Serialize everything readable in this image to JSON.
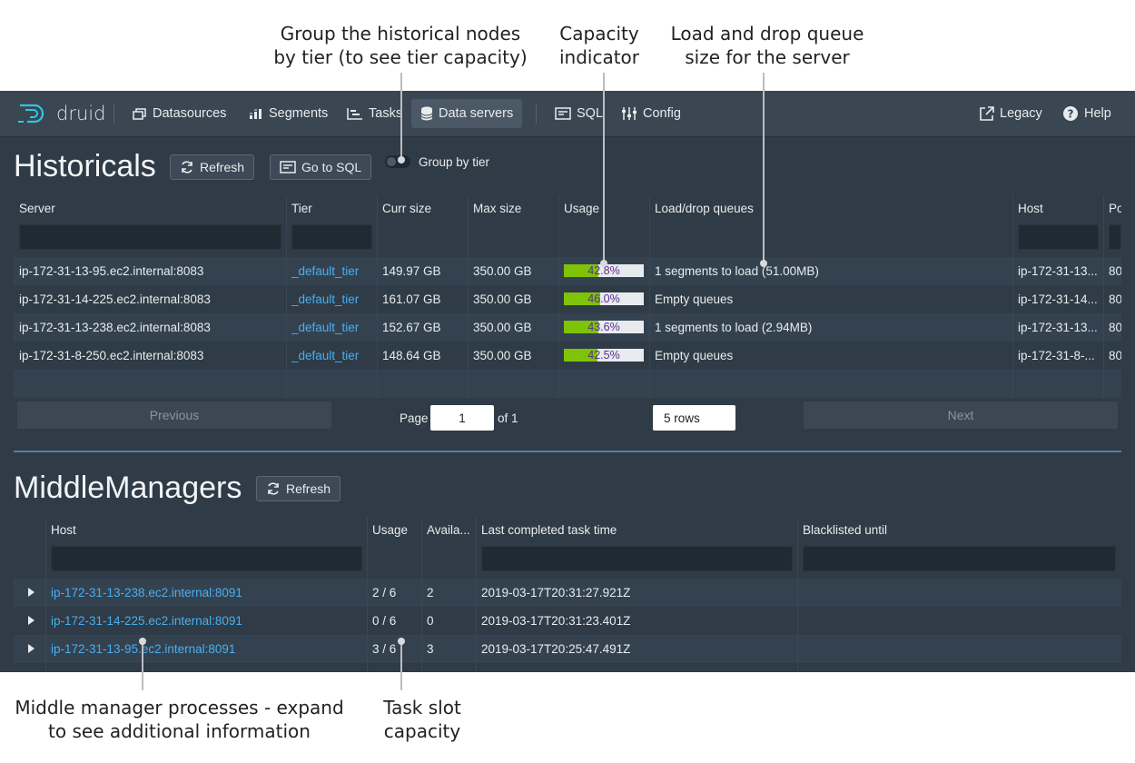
{
  "annotations": {
    "group_by_tier": "Group the historical nodes\nby tier (to see tier capacity)",
    "capacity": "Capacity\nindicator",
    "load_drop": "Load and drop queue\nsize for the server",
    "middle_managers": "Middle manager processes - expand\nto see additional information",
    "task_slot": "Task slot\ncapacity"
  },
  "nav": {
    "brand": "druid",
    "items": [
      "Datasources",
      "Segments",
      "Tasks",
      "Data servers",
      "SQL",
      "Config"
    ],
    "active": "Data servers",
    "right": [
      "Legacy",
      "Help"
    ]
  },
  "historicals": {
    "title": "Historicals",
    "refresh": "Refresh",
    "go_to_sql": "Go to SQL",
    "group_by_tier": "Group by tier",
    "columns": [
      "Server",
      "Tier",
      "Curr size",
      "Max size",
      "Usage",
      "Load/drop queues",
      "Host",
      "Po"
    ],
    "rows": [
      {
        "server": "ip-172-31-13-95.ec2.internal:8083",
        "tier": "_default_tier",
        "curr": "149.97 GB",
        "max": "350.00 GB",
        "usage": "42.8%",
        "usage_frac": 0.428,
        "queue": "1 segments to load (51.00MB)",
        "host": "ip-172-31-13...",
        "port": "80"
      },
      {
        "server": "ip-172-31-14-225.ec2.internal:8083",
        "tier": "_default_tier",
        "curr": "161.07 GB",
        "max": "350.00 GB",
        "usage": "46.0%",
        "usage_frac": 0.46,
        "queue": "Empty queues",
        "host": "ip-172-31-14...",
        "port": "80"
      },
      {
        "server": "ip-172-31-13-238.ec2.internal:8083",
        "tier": "_default_tier",
        "curr": "152.67 GB",
        "max": "350.00 GB",
        "usage": "43.6%",
        "usage_frac": 0.436,
        "queue": "1 segments to load (2.94MB)",
        "host": "ip-172-31-13...",
        "port": "80"
      },
      {
        "server": "ip-172-31-8-250.ec2.internal:8083",
        "tier": "_default_tier",
        "curr": "148.64 GB",
        "max": "350.00 GB",
        "usage": "42.5%",
        "usage_frac": 0.425,
        "queue": "Empty queues",
        "host": "ip-172-31-8-...",
        "port": "80"
      }
    ],
    "pagination": {
      "previous": "Previous",
      "page_label": "Page",
      "page": "1",
      "of": "of 1",
      "rows": "5 rows",
      "next": "Next"
    }
  },
  "middle_managers": {
    "title": "MiddleManagers",
    "refresh": "Refresh",
    "columns": [
      "Host",
      "Usage",
      "Availa...",
      "Last completed task time",
      "Blacklisted until"
    ],
    "rows": [
      {
        "host": "ip-172-31-13-238.ec2.internal:8091",
        "usage": "2 / 6",
        "avail": "2",
        "last": "2019-03-17T20:31:27.921Z"
      },
      {
        "host": "ip-172-31-14-225.ec2.internal:8091",
        "usage": "0 / 6",
        "avail": "0",
        "last": "2019-03-17T20:31:23.401Z"
      },
      {
        "host": "ip-172-31-13-95.ec2.internal:8091",
        "usage": "3 / 6",
        "avail": "3",
        "last": "2019-03-17T20:25:47.491Z"
      }
    ]
  }
}
